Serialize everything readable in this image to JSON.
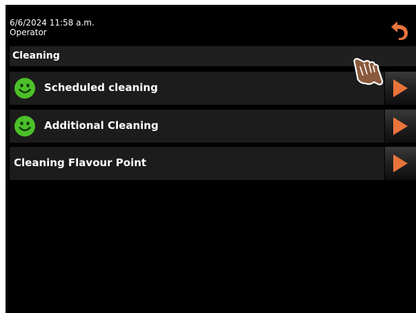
{
  "status": {
    "datetime": "6/6/2024 11:58 a.m.",
    "user_role": "Operator",
    "back_icon": "back-arrow-icon",
    "accent_color": "#e8743c"
  },
  "section": {
    "title": "Cleaning"
  },
  "rows": [
    {
      "label": "Scheduled cleaning",
      "icon": "smiley-ok-icon",
      "status": "ok",
      "status_color": "#4cc02a"
    },
    {
      "label": "Additional Cleaning",
      "icon": "smiley-ok-icon",
      "status": "ok",
      "status_color": "#4cc02a"
    },
    {
      "label": "Cleaning Flavour Point",
      "icon": null,
      "status": null
    }
  ],
  "arrow_icon": "play-right-icon",
  "arrow_color": "#e8743c",
  "pointer_icon": "hand-pointer-icon"
}
